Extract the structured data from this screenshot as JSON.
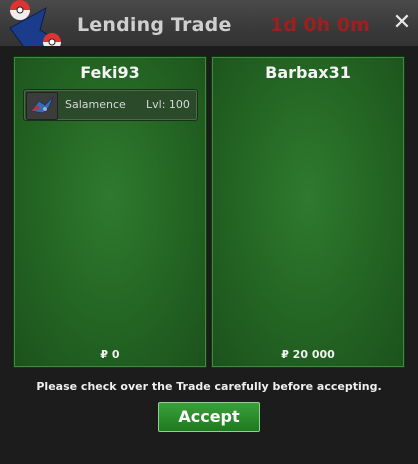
{
  "window": {
    "title": "Lending Trade",
    "timer": "1d 0h 0m",
    "close_label": "✕"
  },
  "left_panel": {
    "player": "Feki93",
    "items": [
      {
        "name": "Salamence",
        "level": "Lvl: 100",
        "icon": "salamence-icon"
      }
    ],
    "money": "₽ 0"
  },
  "right_panel": {
    "player": "Barbax31",
    "items": [],
    "money": "₽ 20 000"
  },
  "notice": "Please check over the Trade carefully before accepting.",
  "accept_label": "Accept",
  "colors": {
    "timer": "#9e1f1f",
    "panel_green": "#236423",
    "accept_green": "#2a8a2a"
  }
}
